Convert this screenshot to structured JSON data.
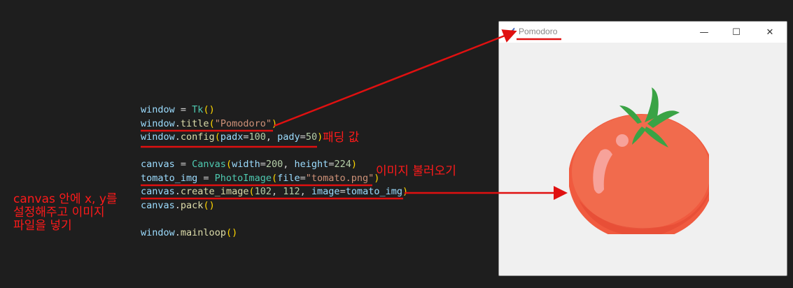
{
  "code_lines": [
    [
      {
        "t": "window",
        "c": "var"
      },
      {
        "t": " = ",
        "c": "op"
      },
      {
        "t": "Tk",
        "c": "cls"
      },
      {
        "t": "()",
        "c": "par"
      }
    ],
    [
      {
        "t": "window",
        "c": "var"
      },
      {
        "t": ".",
        "c": "op"
      },
      {
        "t": "title",
        "c": "fn"
      },
      {
        "t": "(",
        "c": "par"
      },
      {
        "t": "\"Pomodoro\"",
        "c": "str"
      },
      {
        "t": ")",
        "c": "par"
      }
    ],
    [
      {
        "t": "window",
        "c": "var"
      },
      {
        "t": ".",
        "c": "op"
      },
      {
        "t": "config",
        "c": "fn"
      },
      {
        "t": "(",
        "c": "par"
      },
      {
        "t": "padx",
        "c": "var"
      },
      {
        "t": "=",
        "c": "op"
      },
      {
        "t": "100",
        "c": "num"
      },
      {
        "t": ", ",
        "c": "op"
      },
      {
        "t": "pady",
        "c": "var"
      },
      {
        "t": "=",
        "c": "op"
      },
      {
        "t": "50",
        "c": "num"
      },
      {
        "t": ")",
        "c": "par"
      }
    ],
    [],
    [
      {
        "t": "canvas",
        "c": "var"
      },
      {
        "t": " = ",
        "c": "op"
      },
      {
        "t": "Canvas",
        "c": "cls"
      },
      {
        "t": "(",
        "c": "par"
      },
      {
        "t": "width",
        "c": "var"
      },
      {
        "t": "=",
        "c": "op"
      },
      {
        "t": "200",
        "c": "num"
      },
      {
        "t": ", ",
        "c": "op"
      },
      {
        "t": "height",
        "c": "var"
      },
      {
        "t": "=",
        "c": "op"
      },
      {
        "t": "224",
        "c": "num"
      },
      {
        "t": ")",
        "c": "par"
      }
    ],
    [
      {
        "t": "tomato_img",
        "c": "var"
      },
      {
        "t": " = ",
        "c": "op"
      },
      {
        "t": "PhotoImage",
        "c": "cls"
      },
      {
        "t": "(",
        "c": "par"
      },
      {
        "t": "file",
        "c": "var"
      },
      {
        "t": "=",
        "c": "op"
      },
      {
        "t": "\"tomato.png\"",
        "c": "str"
      },
      {
        "t": ")",
        "c": "par"
      }
    ],
    [
      {
        "t": "canvas",
        "c": "var"
      },
      {
        "t": ".",
        "c": "op"
      },
      {
        "t": "create_image",
        "c": "fn"
      },
      {
        "t": "(",
        "c": "par"
      },
      {
        "t": "102",
        "c": "num"
      },
      {
        "t": ", ",
        "c": "op"
      },
      {
        "t": "112",
        "c": "num"
      },
      {
        "t": ", ",
        "c": "op"
      },
      {
        "t": "image",
        "c": "var"
      },
      {
        "t": "=",
        "c": "op"
      },
      {
        "t": "tomato_img",
        "c": "var"
      },
      {
        "t": ")",
        "c": "par"
      }
    ],
    [
      {
        "t": "canvas",
        "c": "var"
      },
      {
        "t": ".",
        "c": "op"
      },
      {
        "t": "pack",
        "c": "fn"
      },
      {
        "t": "()",
        "c": "par"
      }
    ],
    [],
    [
      {
        "t": "window",
        "c": "var"
      },
      {
        "t": ".",
        "c": "op"
      },
      {
        "t": "mainloop",
        "c": "fn"
      },
      {
        "t": "()",
        "c": "par"
      }
    ]
  ],
  "annotations": {
    "padding": "패딩 값",
    "load_image": "이미지 불러오기",
    "canvas_note": "canvas 안에 x, y를\n설정해주고 이미지\n파일을 넣기"
  },
  "window": {
    "title": "Pomodoro",
    "minimize_glyph": "—",
    "maximize_glyph": "☐",
    "close_glyph": "✕",
    "canvas_image": "tomato-image"
  },
  "colors": {
    "annotation_red": "#ff1a1a",
    "editor_bg": "#1e1e1e",
    "window_bg": "#f0f0f0",
    "tomato": "#f05a3f",
    "leaf": "#3aa345"
  }
}
